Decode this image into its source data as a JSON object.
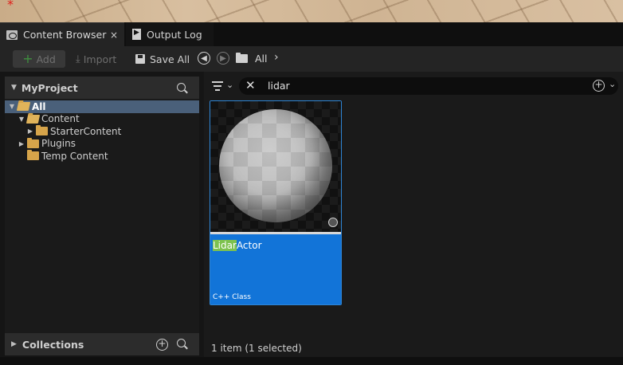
{
  "tabs": [
    {
      "label": "Content Browser",
      "close": "×"
    },
    {
      "label": "Output Log"
    }
  ],
  "toolbar": {
    "add_label": "Add",
    "import_label": "Import",
    "save_all_label": "Save All",
    "path_label": "All",
    "path_chevron": "›"
  },
  "sources": {
    "title": "MyProject",
    "tree": [
      {
        "label": "All"
      },
      {
        "label": "Content"
      },
      {
        "label": "StarterContent"
      },
      {
        "label": "Plugins"
      },
      {
        "label": "Temp Content"
      }
    ]
  },
  "collections": {
    "title": "Collections"
  },
  "search": {
    "query": "lidar"
  },
  "asset": {
    "name_highlight": "Lidar",
    "name_rest": "Actor",
    "class_label": "C++ Class"
  },
  "status": {
    "text": "1 item (1 selected)"
  },
  "icons": {
    "content_browser": "content-browser-icon",
    "output_log": "output-log-icon",
    "save": "save-icon",
    "folder": "folder-icon"
  },
  "colors": {
    "selection_blue": "#1274d8",
    "tree_selected": "#4a607a",
    "folder": "#d6a44a",
    "search_highlight": "#7dc24e"
  }
}
